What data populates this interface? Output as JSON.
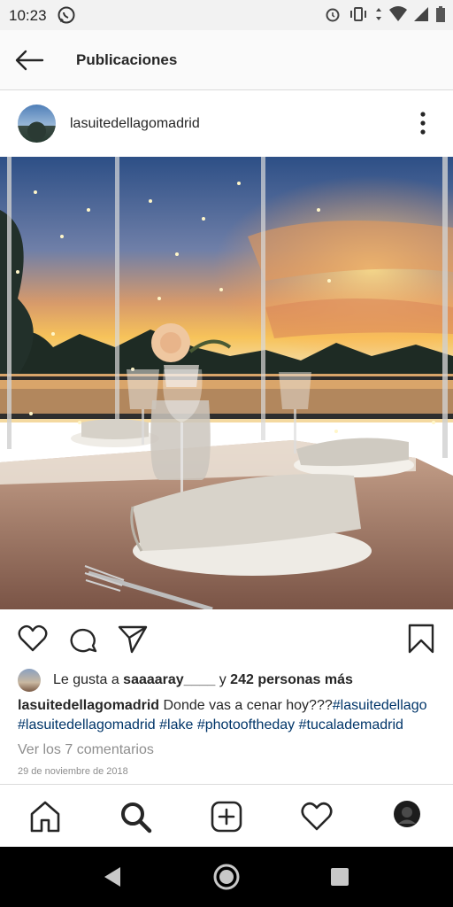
{
  "status_bar": {
    "time": "10:23",
    "icons": [
      "whatsapp-icon",
      "alarm-icon",
      "vibrate-icon",
      "data-arrows-icon",
      "wifi-icon",
      "signal-icon",
      "battery-icon"
    ]
  },
  "header": {
    "title": "Publicaciones",
    "back_icon": "arrow-left-icon"
  },
  "post": {
    "username": "lasuitedellagomadrid",
    "more_icon": "more-vertical-icon",
    "photo_description_icon": "photo",
    "actions": {
      "like_icon": "heart-outline-icon",
      "comment_icon": "comment-icon",
      "share_icon": "send-icon",
      "save_icon": "bookmark-icon"
    },
    "likes": {
      "prefix": "Le gusta a ",
      "user": "saaaaray____",
      "connector": " y ",
      "others": "242 personas más"
    },
    "caption": {
      "user": "lasuitedellagomadrid",
      "text": " Donde vas a cenar hoy???",
      "tags": [
        "#lasuitedellago",
        "#lasuitedellagomadrid",
        "#lake",
        "#photooftheday",
        "#tucalademadrid"
      ]
    },
    "comments_link": "Ver los 7 comentarios",
    "date": "29 de noviembre de 2018"
  },
  "bottom_nav": {
    "items": [
      "home-icon",
      "search-icon",
      "add-post-icon",
      "activity-heart-icon",
      "profile-avatar"
    ]
  },
  "system_nav": {
    "items": [
      "back-triangle-icon",
      "home-circle-icon",
      "recents-square-icon"
    ]
  },
  "colors": {
    "hashtag": "#003569",
    "muted": "#8e8e8e",
    "text": "#262626",
    "divider": "#dbdbdb"
  }
}
